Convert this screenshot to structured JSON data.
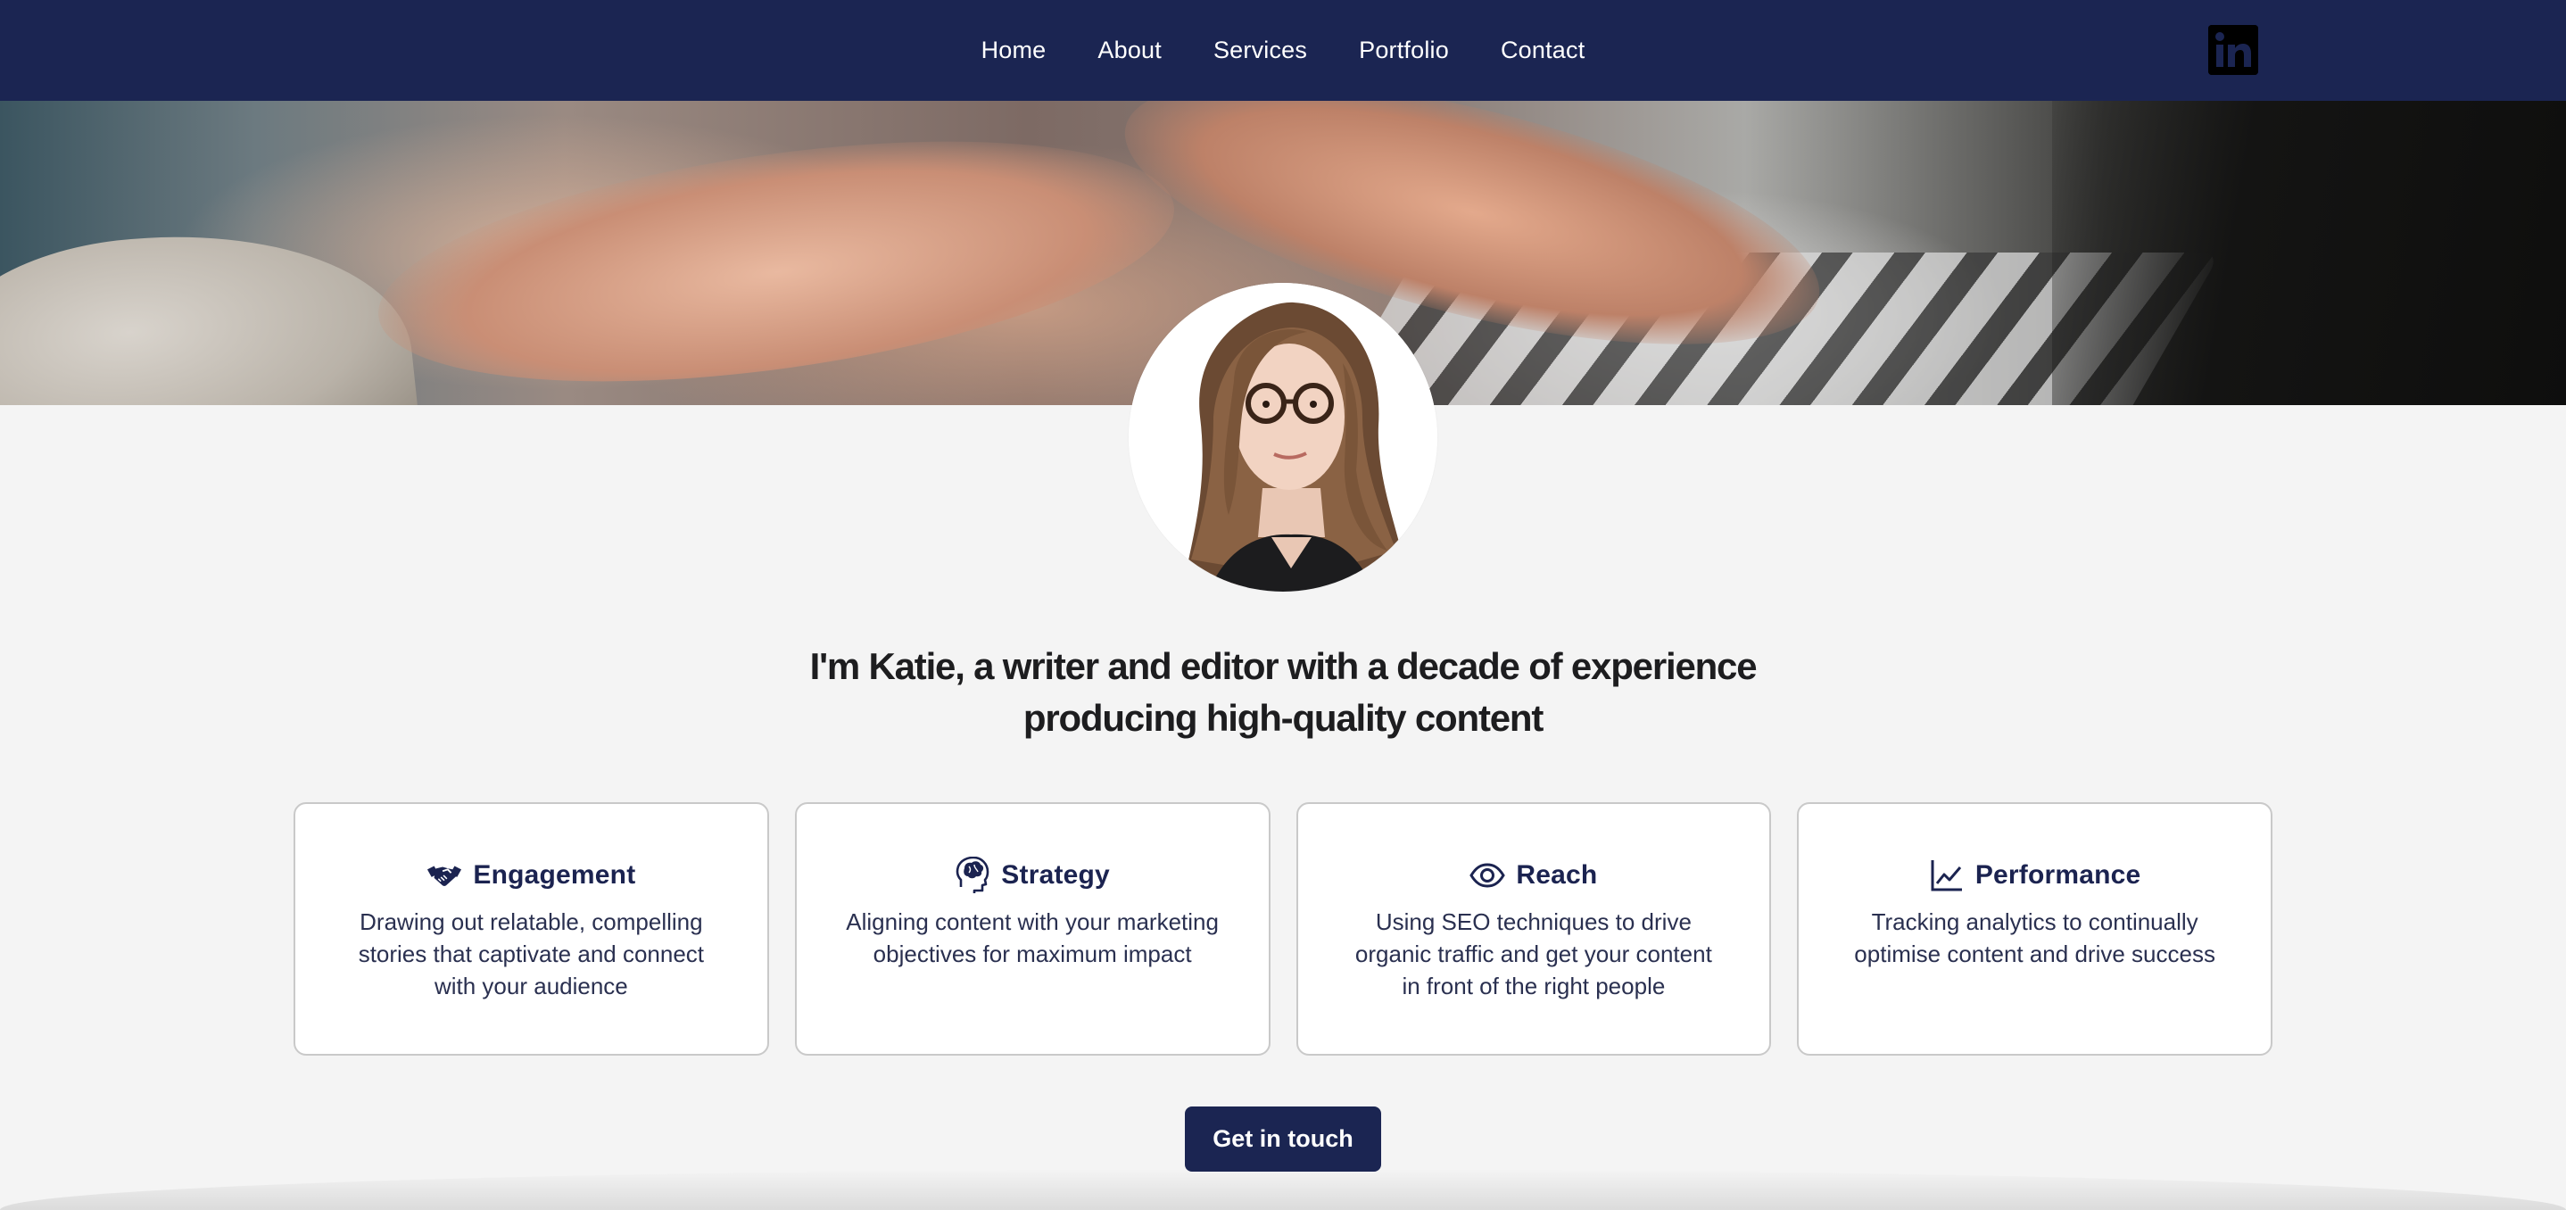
{
  "nav": {
    "links": [
      "Home",
      "About",
      "Services",
      "Portfolio",
      "Contact"
    ],
    "social_icon": "linkedin-icon"
  },
  "hero": {
    "image": "hands-typing-on-laptop-photo"
  },
  "profile": {
    "avatar": "portrait-photo"
  },
  "intro": {
    "prefix": "I'm ",
    "name": "Katie",
    "line1_rest": ", a writer and editor with a decade of experience",
    "line2": "producing high-quality content"
  },
  "cards": [
    {
      "icon": "handshake-icon",
      "title": "Engagement",
      "text": "Drawing out relatable, compelling stories that captivate and connect with your audience"
    },
    {
      "icon": "brain-head-icon",
      "title": "Strategy",
      "text": "Aligning content with your marketing objectives for maximum impact"
    },
    {
      "icon": "eye-icon",
      "title": "Reach",
      "text": "Using SEO techniques to drive organic traffic and get your content in front of the right people"
    },
    {
      "icon": "line-chart-icon",
      "title": "Performance",
      "text": "Tracking analytics to continually optimise content and drive success"
    }
  ],
  "cta": {
    "label": "Get in touch"
  },
  "colors": {
    "navy": "#1b2552",
    "background": "#f4f4f4",
    "card_border": "#c9c9c9"
  }
}
